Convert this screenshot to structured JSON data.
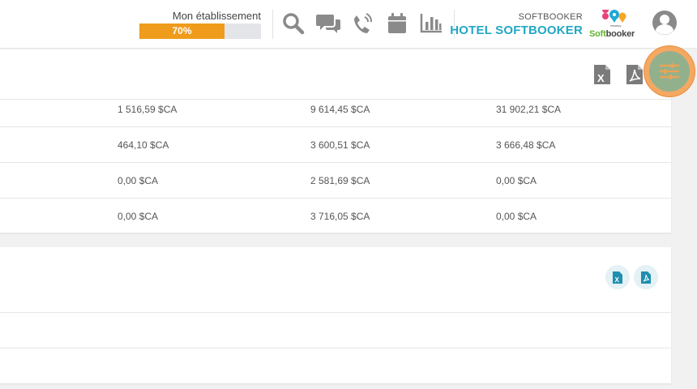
{
  "header": {
    "establishment_label": "Mon établissement",
    "progress_percent": 70,
    "progress_text": "70%",
    "hotel_sub": "SOFTBOOKER",
    "hotel_name": "HOTEL SOFTBOOKER",
    "logo_prefix": "Soft",
    "logo_suffix": "booker",
    "icons": [
      "search-icon",
      "chat-icon",
      "phone-icon",
      "calendar-icon",
      "bar-chart-icon",
      "user-avatar-icon"
    ],
    "accent_color": "#23a7c4",
    "progress_color": "#ef9b1b"
  },
  "card1": {
    "export_icons": [
      "excel-export-icon",
      "pdf-export-icon",
      "filter-settings-icon"
    ],
    "rows": [
      [
        "1 516,59 $CA",
        "9 614,45 $CA",
        "31 902,21 $CA"
      ],
      [
        "464,10 $CA",
        "3 600,51 $CA",
        "3 666,48 $CA"
      ],
      [
        "0,00 $CA",
        "2 581,69 $CA",
        "0,00 $CA"
      ],
      [
        "0,00 $CA",
        "3 716,05 $CA",
        "0,00 $CA"
      ]
    ]
  },
  "card2": {
    "export_icons": [
      "excel-export-icon",
      "pdf-export-icon"
    ]
  }
}
